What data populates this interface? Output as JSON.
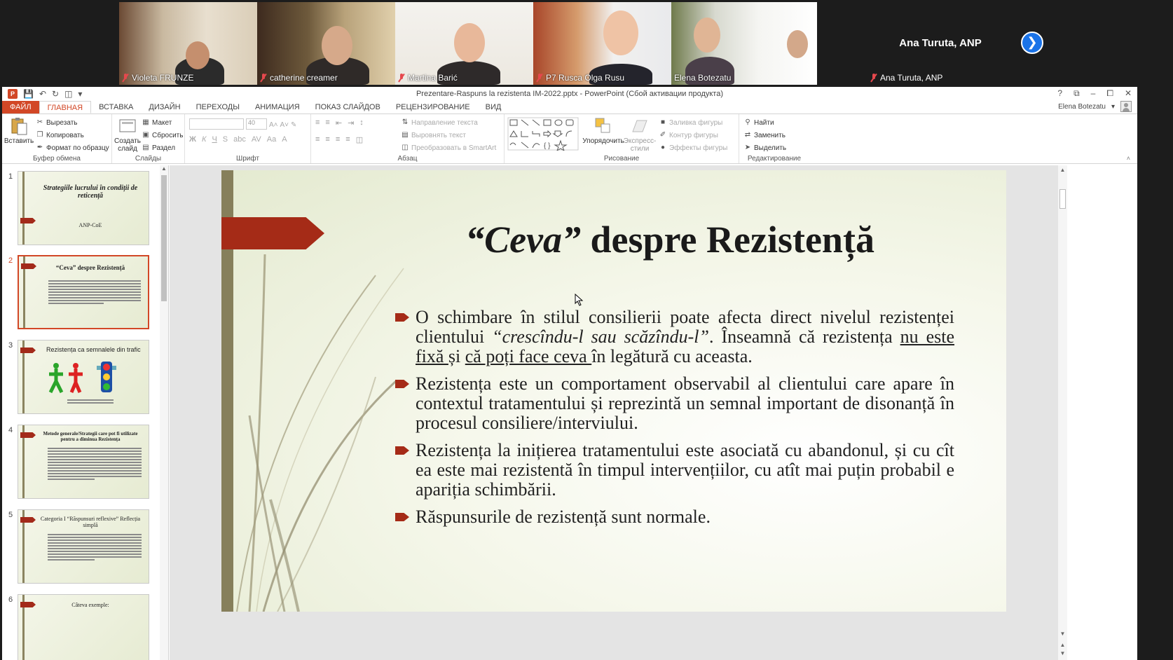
{
  "video": {
    "participants": [
      {
        "name": "Violeta FRUNZE",
        "muted": true
      },
      {
        "name": "catherine creamer",
        "muted": true
      },
      {
        "name": "Martina Barić",
        "muted": true
      },
      {
        "name": "P7 Rusca Olga Rusu",
        "muted": true
      },
      {
        "name": "Elena Botezatu",
        "muted": false,
        "active": true
      },
      {
        "name": "Ana Turuta, ANP",
        "muted": true
      }
    ],
    "featured_name": "Ana Turuta, ANP",
    "next_icon": "chevron-right-icon"
  },
  "ppt": {
    "doc_title": "Prezentare-Raspuns la rezistenta IM-2022.pptx - PowerPoint (Сбой активации продукта)",
    "window_controls": [
      "?",
      "⧉",
      "–",
      "⧠",
      "✕"
    ],
    "user_name": "Elena Botezatu",
    "tabs": [
      "ФАЙЛ",
      "ГЛАВНАЯ",
      "ВСТАВКА",
      "ДИЗАЙН",
      "ПЕРЕХОДЫ",
      "АНИМАЦИЯ",
      "ПОКАЗ СЛАЙДОВ",
      "РЕЦЕНЗИРОВАНИЕ",
      "ВИД"
    ],
    "active_tab": "ГЛАВНАЯ",
    "ribbon": {
      "clipboard": {
        "label": "Буфер обмена",
        "paste": "Вставить",
        "cut": "Вырезать",
        "copy": "Копировать",
        "format_painter": "Формат по образцу"
      },
      "slides": {
        "label": "Слайды",
        "new_slide": "Создать слайд",
        "layout": "Макет",
        "reset": "Сбросить",
        "section": "Раздел"
      },
      "font": {
        "label": "Шрифт",
        "size": "40"
      },
      "paragraph": {
        "label": "Абзац",
        "text_direction": "Направление текста",
        "align_text": "Выровнять текст",
        "smartart": "Преобразовать в SmartArt"
      },
      "drawing": {
        "label": "Рисование",
        "arrange": "Упорядочить",
        "quick_styles": "Экспресс-стили",
        "fill": "Заливка фигуры",
        "outline": "Контур фигуры",
        "effects": "Эффекты фигуры"
      },
      "editing": {
        "label": "Редактирование",
        "find": "Найти",
        "replace": "Заменить",
        "select": "Выделить"
      }
    },
    "thumbnails": [
      {
        "num": "1",
        "title": "Strategiile lucrului în condiții de reticență",
        "subtitle": "ANP-CoE"
      },
      {
        "num": "2",
        "title": "“Ceva” despre Rezistență",
        "selected": true
      },
      {
        "num": "3",
        "title": "Rezistența ca semnalele din trafic"
      },
      {
        "num": "4",
        "title": "Metode generale/Strategii care pot fi utilizate pentru a diminua Rezistența"
      },
      {
        "num": "5",
        "title": "Categoria I “Răspunsuri reflexive” Reflecția simplă"
      },
      {
        "num": "6",
        "title": "Câteva exemple:"
      }
    ],
    "slide": {
      "title_italic": "“Ceva”",
      "title_rest": " despre Rezistență",
      "bullets": [
        {
          "parts": [
            {
              "t": "O schimbare în stilul consilierii poate afecta direct nivelul rezistenței clientului "
            },
            {
              "t": "“crescîndu-l sau scăzîndu-l”",
              "i": true
            },
            {
              "t": ". Înseamnă că rezistența "
            },
            {
              "t": "nu este fixă ",
              "u": true
            },
            {
              "t": "și "
            },
            {
              "t": "că poți face ceva ",
              "u": true
            },
            {
              "t": "în legătură cu aceasta."
            }
          ]
        },
        {
          "parts": [
            {
              "t": "Rezistența este un comportament observabil al clientului care apare în contextul tratamentului și reprezintă un semnal important de disonanță în procesul consiliere/interviului."
            }
          ]
        },
        {
          "parts": [
            {
              "t": "Rezistența la inițierea tratamentului este asociată cu abandonul, și cu cît ea este mai rezistentă în timpul intervențiilor, cu atît mai puțin probabil e apariția schimbării."
            }
          ]
        },
        {
          "parts": [
            {
              "t": "Răspunsurile de rezistență sunt normale."
            }
          ]
        }
      ]
    }
  }
}
